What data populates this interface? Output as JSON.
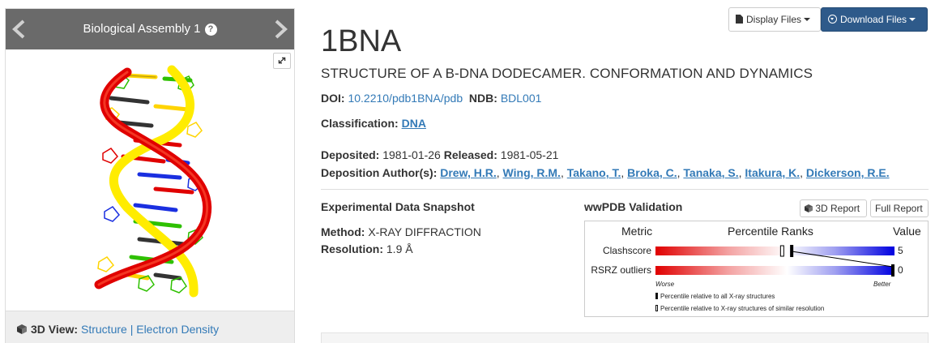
{
  "carousel": {
    "title": "Biological Assembly 1",
    "help_glyph": "?",
    "footer": {
      "label": "3D View:",
      "structure_link": "Structure",
      "separator": "|",
      "density_link": "Electron Density"
    },
    "icons": [
      "chevron-left-icon",
      "chevron-right-icon",
      "help-icon",
      "expand-icon",
      "cube-icon"
    ]
  },
  "toolbar": {
    "display_files": "Display Files",
    "download_files": "Download Files"
  },
  "entry": {
    "id": "1BNA",
    "title": "STRUCTURE OF A B-DNA DODECAMER. CONFORMATION AND DYNAMICS",
    "doi_label": "DOI:",
    "doi_value": "10.2210/pdb1BNA/pdb",
    "ndb_label": "NDB:",
    "ndb_value": "BDL001",
    "classification_label": "Classification:",
    "classification_value": "DNA",
    "deposited_label": "Deposited:",
    "deposited_value": "1981-01-26",
    "released_label": "Released:",
    "released_value": "1981-05-21",
    "authors_label": "Deposition Author(s):",
    "authors": [
      "Drew, H.R.",
      "Wing, R.M.",
      "Takano, T.",
      "Broka, C.",
      "Tanaka, S.",
      "Itakura, K.",
      "Dickerson, R.E."
    ]
  },
  "snapshot": {
    "title": "Experimental Data Snapshot",
    "method_label": "Method:",
    "method_value": "X-RAY DIFFRACTION",
    "resolution_label": "Resolution:",
    "resolution_value": "1.9 Å"
  },
  "validation": {
    "title": "wwPDB Validation",
    "report_3d": "3D Report",
    "full_report": "Full Report",
    "col_metric": "Metric",
    "col_ranks": "Percentile Ranks",
    "col_value": "Value",
    "metrics": [
      {
        "name": "Clashscore",
        "value": "5",
        "percentile_all": 0.57,
        "percentile_similar": 0.53
      },
      {
        "name": "RSRZ outliers",
        "value": "0",
        "percentile_all": 1.0,
        "percentile_similar": 1.0
      }
    ],
    "worse_label": "Worse",
    "better_label": "Better",
    "legend_all": "Percentile relative to all X-ray structures",
    "legend_similar": "Percentile relative to X-ray structures of similar resolution",
    "colors": {
      "worse": "#e00000",
      "better": "#0000e0"
    }
  }
}
